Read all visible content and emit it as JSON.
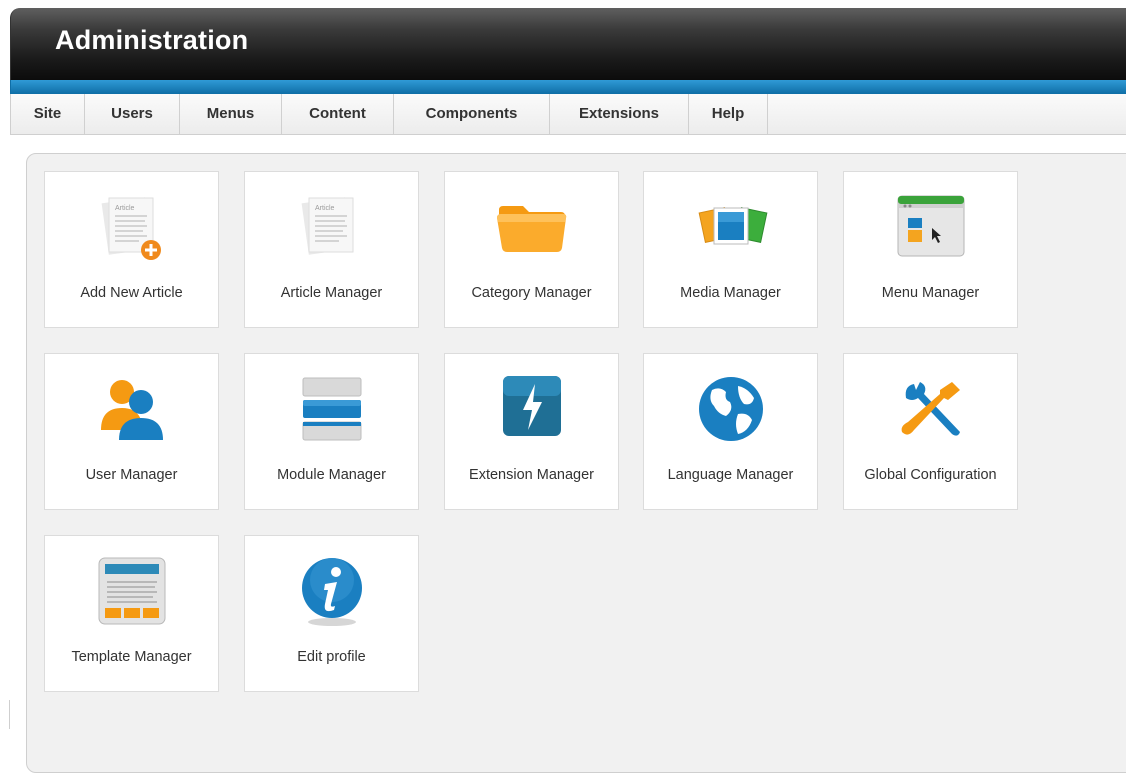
{
  "header": {
    "title": "Administration"
  },
  "menu": {
    "items": [
      {
        "label": "Site"
      },
      {
        "label": "Users"
      },
      {
        "label": "Menus"
      },
      {
        "label": "Content"
      },
      {
        "label": "Components"
      },
      {
        "label": "Extensions"
      },
      {
        "label": "Help"
      }
    ]
  },
  "tiles": [
    {
      "label": "Add New Article",
      "icon": "add-article-icon"
    },
    {
      "label": "Article Manager",
      "icon": "article-icon"
    },
    {
      "label": "Category Manager",
      "icon": "folder-icon"
    },
    {
      "label": "Media Manager",
      "icon": "media-icon"
    },
    {
      "label": "Menu Manager",
      "icon": "menu-window-icon"
    },
    {
      "label": "User Manager",
      "icon": "users-icon"
    },
    {
      "label": "Module Manager",
      "icon": "module-stack-icon"
    },
    {
      "label": "Extension Manager",
      "icon": "lightning-icon"
    },
    {
      "label": "Language Manager",
      "icon": "globe-icon"
    },
    {
      "label": "Global Configuration",
      "icon": "wrench-screwdriver-icon"
    },
    {
      "label": "Template Manager",
      "icon": "template-icon"
    },
    {
      "label": "Edit profile",
      "icon": "info-icon"
    }
  ],
  "icon_text": {
    "article": "Article"
  },
  "colors": {
    "accent_blue": "#1a7fc1",
    "folder_orange": "#f7a21b",
    "header_dark": "#1b1b1b"
  }
}
